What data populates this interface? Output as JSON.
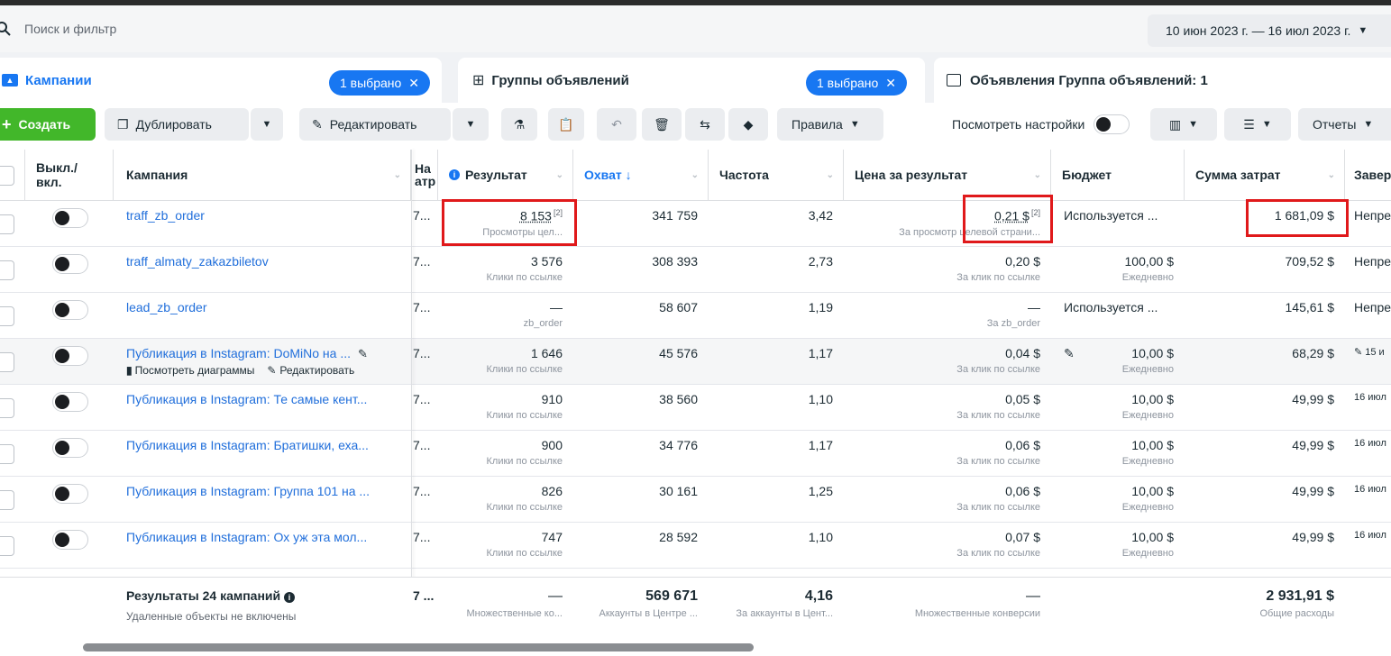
{
  "search": {
    "placeholder": "Поиск и фильтр"
  },
  "date_range": "10 июн 2023 г. — 16 июл 2023 г.",
  "tabs": [
    {
      "label": "Кампании",
      "chip": "1 выбрано"
    },
    {
      "label": "Группы объявлений",
      "chip": "1 выбрано"
    },
    {
      "label": "Объявления Группа объявлений: 1"
    }
  ],
  "toolbar": {
    "create": "Создать",
    "duplicate": "Дублировать",
    "edit": "Редактировать",
    "rules": "Правила",
    "view_settings": "Посмотреть настройки",
    "reports": "Отчеты"
  },
  "columns": {
    "toggle": "Выкл./\nвкл.",
    "campaign": "Кампания",
    "delivery": "На\nатр",
    "result": "Результат",
    "reach": "Охват ↓",
    "frequency": "Частота",
    "cost_per_result": "Цена за результат",
    "budget": "Бюджет",
    "spent": "Сумма затрат",
    "ends": "Завер"
  },
  "rows": [
    {
      "name": "traff_zb_order",
      "delivery": "7...",
      "result": "8 153",
      "result_sub": "Просмотры цел...",
      "reach": "341 759",
      "freq": "3,42",
      "cpr": "0,21 $",
      "cpr_sub": "За просмотр целевой страни...",
      "budget": "Используется ...",
      "budget_sub": "",
      "spent": "1 681,09 $",
      "ends": "Непре"
    },
    {
      "name": "traff_almaty_zakazbiletov",
      "delivery": "7...",
      "result": "3 576",
      "result_sub": "Клики по ссылке",
      "reach": "308 393",
      "freq": "2,73",
      "cpr": "0,20 $",
      "cpr_sub": "За клик по ссылке",
      "budget": "100,00 $",
      "budget_sub": "Ежедневно",
      "spent": "709,52 $",
      "ends": "Непре"
    },
    {
      "name": "lead_zb_order",
      "delivery": "7...",
      "result": "—",
      "result_sub": "zb_order",
      "reach": "58 607",
      "freq": "1,19",
      "cpr": "—",
      "cpr_sub": "За zb_order",
      "budget": "Используется ...",
      "budget_sub": "",
      "spent": "145,61 $",
      "ends": "Непре"
    },
    {
      "name": "Публикация в Instagram: DoMiNo на ...",
      "delivery": "7...",
      "result": "1 646",
      "result_sub": "Клики по ссылке",
      "reach": "45 576",
      "freq": "1,17",
      "cpr": "0,04 $",
      "cpr_sub": "За клик по ссылке",
      "budget": "10,00 $",
      "budget_sub": "Ежедневно",
      "spent": "68,29 $",
      "ends": "15 и",
      "actions": {
        "charts": "Посмотреть диаграммы",
        "edit": "Редактировать"
      }
    },
    {
      "name": "Публикация в Instagram: Те самые кент...",
      "delivery": "7...",
      "result": "910",
      "result_sub": "Клики по ссылке",
      "reach": "38 560",
      "freq": "1,10",
      "cpr": "0,05 $",
      "cpr_sub": "За клик по ссылке",
      "budget": "10,00 $",
      "budget_sub": "Ежедневно",
      "spent": "49,99 $",
      "ends": "16 июл"
    },
    {
      "name": "Публикация в Instagram: Братишки, еха...",
      "delivery": "7...",
      "result": "900",
      "result_sub": "Клики по ссылке",
      "reach": "34 776",
      "freq": "1,17",
      "cpr": "0,06 $",
      "cpr_sub": "За клик по ссылке",
      "budget": "10,00 $",
      "budget_sub": "Ежедневно",
      "spent": "49,99 $",
      "ends": "16 июл"
    },
    {
      "name": "Публикация в Instagram: Группа 101 на ...",
      "delivery": "7...",
      "result": "826",
      "result_sub": "Клики по ссылке",
      "reach": "30 161",
      "freq": "1,25",
      "cpr": "0,06 $",
      "cpr_sub": "За клик по ссылке",
      "budget": "10,00 $",
      "budget_sub": "Ежедневно",
      "spent": "49,99 $",
      "ends": "16 июл"
    },
    {
      "name": "Публикация в Instagram: Ох уж эта мол...",
      "delivery": "7...",
      "result": "747",
      "result_sub": "Клики по ссылке",
      "reach": "28 592",
      "freq": "1,10",
      "cpr": "0,07 $",
      "cpr_sub": "За клик по ссылке",
      "budget": "10,00 $",
      "budget_sub": "Ежедневно",
      "spent": "49,99 $",
      "ends": "16 июл"
    }
  ],
  "footer": {
    "title": "Результаты 24 кампаний",
    "subtitle": "Удаленные объекты не включены",
    "delivery": "7 ...",
    "result": "—",
    "result_sub": "Множественные ко...",
    "reach": "569 671",
    "reach_sub": "Аккаунты в Центре ...",
    "freq": "4,16",
    "freq_sub": "За аккаунты в Цент...",
    "cpr": "—",
    "cpr_sub": "Множественные конверсии",
    "spent": "2 931,91 $",
    "spent_sub": "Общие расходы"
  },
  "colors": {
    "accent": "#1877f2",
    "link": "#216fdb",
    "create_green": "#42b72a",
    "highlight_red": "#e0191b"
  }
}
